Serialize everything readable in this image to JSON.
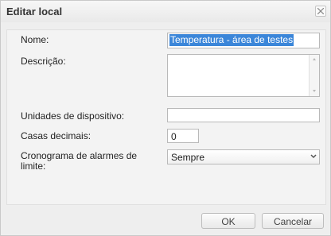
{
  "dialog": {
    "title": "Editar local",
    "close_icon": "close-icon"
  },
  "form": {
    "nome_label": "Nome:",
    "nome_value": "Temperatura - área de testes",
    "descricao_label": "Descrição:",
    "descricao_value": "",
    "unidades_label": "Unidades de dispositivo:",
    "unidades_value": "",
    "casas_label": "Casas decimais:",
    "casas_value": "0",
    "cronograma_label_line1": "Cronograma de alarmes de",
    "cronograma_label_line2": "limite:",
    "cronograma_value": "Sempre"
  },
  "buttons": {
    "ok": "OK",
    "cancel": "Cancelar"
  }
}
